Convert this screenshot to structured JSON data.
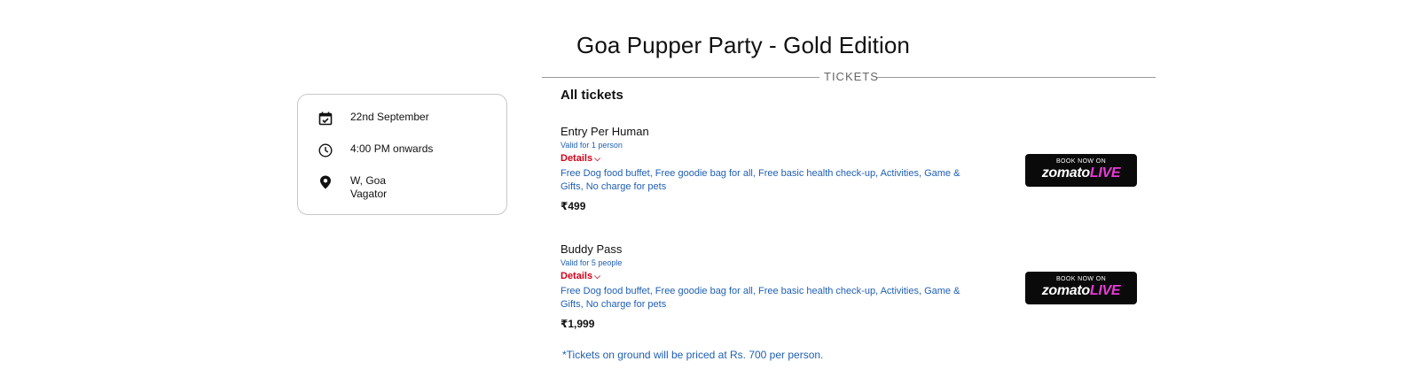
{
  "event": {
    "title": "Goa Pupper Party - Gold Edition"
  },
  "divider": {
    "label": "TICKETS"
  },
  "info": {
    "date": "22nd September",
    "time": "4:00 PM onwards",
    "location_line1": "W, Goa",
    "location_line2": "Vagator",
    "icons": [
      "calendar-check-icon",
      "clock-icon",
      "location-pin-icon"
    ]
  },
  "tickets_section": {
    "heading": "All tickets"
  },
  "tickets": [
    {
      "name": "Entry Per Human",
      "valid": "Valid for 1 person",
      "details_label": "Details",
      "perks": "Free Dog food buffet, Free goodie bag for all, Free basic health check-up, Activities, Game & Gifts, No charge for pets",
      "price": "₹499",
      "button_top": "BOOK NOW ON",
      "button_brand": "zomato",
      "button_brand_suffix": "LIVE"
    },
    {
      "name": "Buddy Pass",
      "valid": "Valid for 5 people",
      "details_label": "Details",
      "perks": "Free Dog food buffet, Free goodie bag for all, Free basic health check-up, Activities, Game & Gifts, No charge for pets",
      "price": "₹1,999",
      "button_top": "BOOK NOW ON",
      "button_brand": "zomato",
      "button_brand_suffix": "LIVE"
    }
  ],
  "footnote": "*Tickets on ground will be priced at Rs. 700 per person.",
  "colors": {
    "accent_link": "#1f5fb5",
    "details_red": "#d0021b",
    "live_magenta": "#e83bd8"
  }
}
